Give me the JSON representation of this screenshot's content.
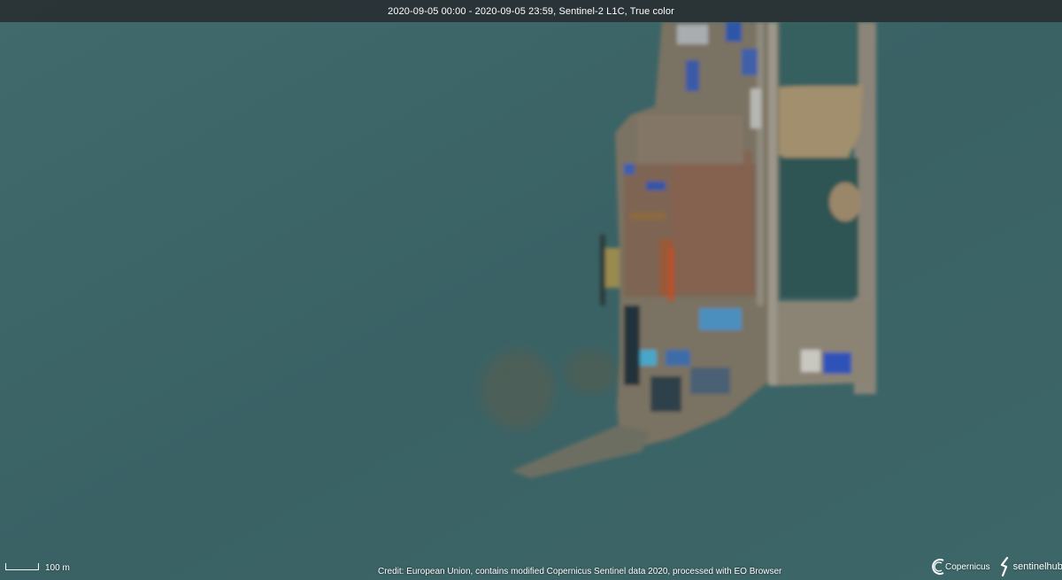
{
  "header": {
    "title": "2020-09-05 00:00 - 2020-09-05 23:59, Sentinel-2 L1C, True color"
  },
  "scale": {
    "label": "100 m"
  },
  "footer": {
    "credit": "Credit: European Union, contains modified Copernicus Sentinel data 2020, processed with EO Browser"
  },
  "logos": {
    "copernicus": "Copernicus",
    "sentinelhub": "sentinelhub"
  },
  "colors": {
    "sea": "#3c6568",
    "land": "#7c7462",
    "header_bg": "#2c3034"
  }
}
